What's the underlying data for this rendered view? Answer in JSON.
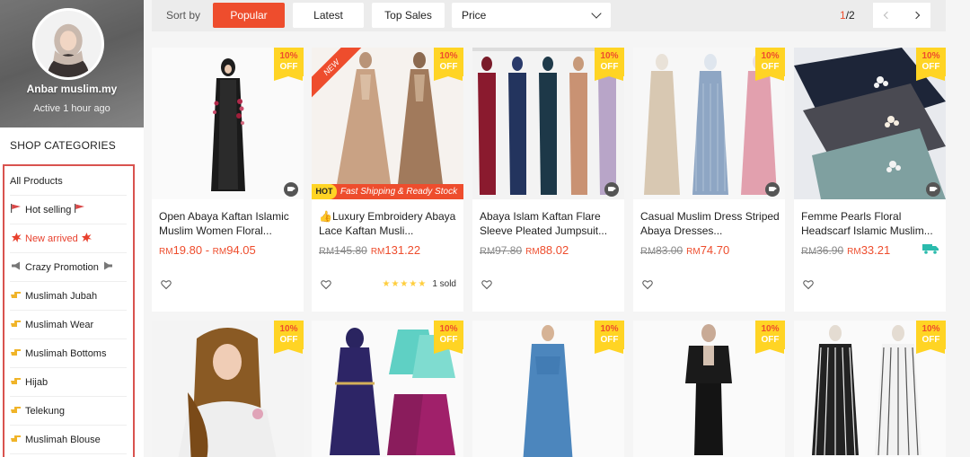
{
  "shop": {
    "name": "Anbar muslim.my",
    "active": "Active 1 hour ago"
  },
  "categories": {
    "title": "SHOP CATEGORIES",
    "items": [
      {
        "label": "All Products",
        "icon": ""
      },
      {
        "label": "Hot selling",
        "icon": "flag-icon"
      },
      {
        "label": "New arrived",
        "icon": "burst-icon"
      },
      {
        "label": "Crazy Promotion",
        "icon": "megaphone-icon"
      },
      {
        "label": "Muslimah Jubah",
        "icon": "pointing-hand-icon"
      },
      {
        "label": "Muslimah Wear",
        "icon": "pointing-hand-icon"
      },
      {
        "label": "Muslimah Bottoms",
        "icon": "pointing-hand-icon"
      },
      {
        "label": "Hijab",
        "icon": "pointing-hand-icon"
      },
      {
        "label": "Telekung",
        "icon": "pointing-hand-icon"
      },
      {
        "label": "Muslimah Blouse",
        "icon": "pointing-hand-icon"
      }
    ]
  },
  "sort": {
    "label": "Sort by",
    "options": [
      "Popular",
      "Latest",
      "Top Sales"
    ],
    "active": "Popular",
    "price_label": "Price"
  },
  "pager": {
    "current": "1",
    "total": "/2"
  },
  "badge": {
    "percent": "10%",
    "off": "OFF"
  },
  "colors": {
    "accent": "#ee4d2d",
    "badge": "#ffd424"
  },
  "products": [
    {
      "title": "Open Abaya Kaftan Islamic Muslim Women Floral...",
      "currency": "RM",
      "price_low": "19.80",
      "sep": " - ",
      "price_high": "94.05",
      "old_price": "",
      "sold": "",
      "rating": 0,
      "video": true
    },
    {
      "title": "👍Luxury Embroidery Abaya Lace Kaftan Musli...",
      "currency": "RM",
      "old_price": "145.80",
      "price": "131.22",
      "sold": "1 sold",
      "rating": 5,
      "new_ribbon": "NEW",
      "hot_tag": "HOT",
      "hot_text": "Fast Shipping & Ready Stock",
      "video": true
    },
    {
      "title": "Abaya Islam Kaftan Flare Sleeve Pleated Jumpsuit...",
      "currency": "RM",
      "old_price": "97.80",
      "price": "88.02",
      "sold": "",
      "rating": 0,
      "video": true
    },
    {
      "title": "Casual Muslim Dress Striped Abaya Dresses...",
      "currency": "RM",
      "old_price": "83.00",
      "price": "74.70",
      "sold": "",
      "rating": 0,
      "video": true
    },
    {
      "title": "Femme Pearls Floral Headscarf Islamic Muslim...",
      "currency": "RM",
      "old_price": "36.90",
      "price": "33.21",
      "sold": "",
      "rating": 0,
      "video": true,
      "shipping_icon": "free-shipping-icon"
    }
  ]
}
